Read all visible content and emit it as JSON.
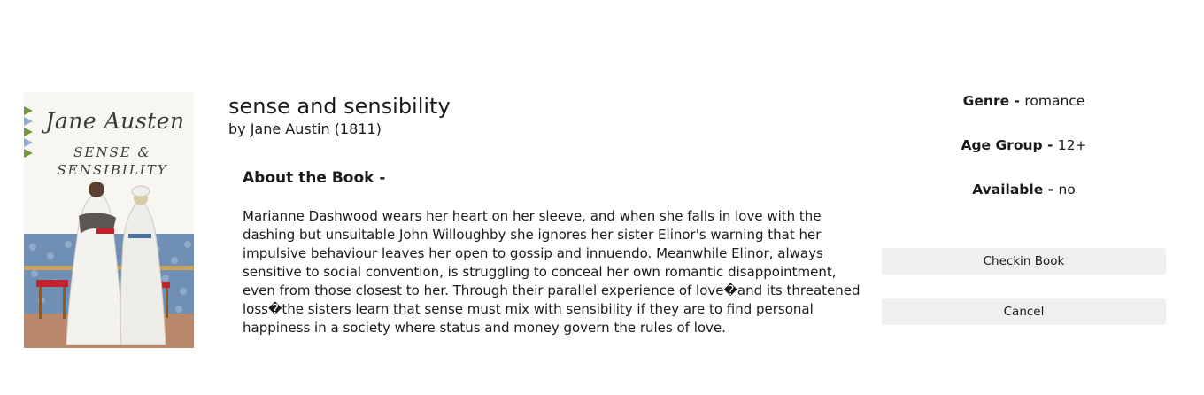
{
  "cover": {
    "author": "Jane Austen",
    "title": "SENSE &\nSENSIBILITY"
  },
  "book": {
    "title": "sense and sensibility",
    "byline": "by Jane Austin (1811)"
  },
  "about": {
    "heading": "About the Book -",
    "description": "Marianne Dashwood wears her heart on her sleeve, and when she falls in love with the dashing but unsuitable John Willoughby she ignores her sister Elinor's warning that her impulsive behaviour leaves her open to gossip and innuendo. Meanwhile Elinor, always sensitive to social convention, is struggling to conceal her own romantic disappointment, even from those closest to her. Through their parallel experience of love�and its threatened loss�the sisters learn that sense must mix with sensibility if they are to find personal happiness in a society where status and money govern the rules of love."
  },
  "details": {
    "genre_label": "Genre -",
    "genre_value": "romance",
    "age_label": "Age Group -",
    "age_value": "12+",
    "available_label": "Available -",
    "available_value": "no"
  },
  "actions": {
    "checkin_label": "Checkin Book",
    "cancel_label": "Cancel"
  }
}
